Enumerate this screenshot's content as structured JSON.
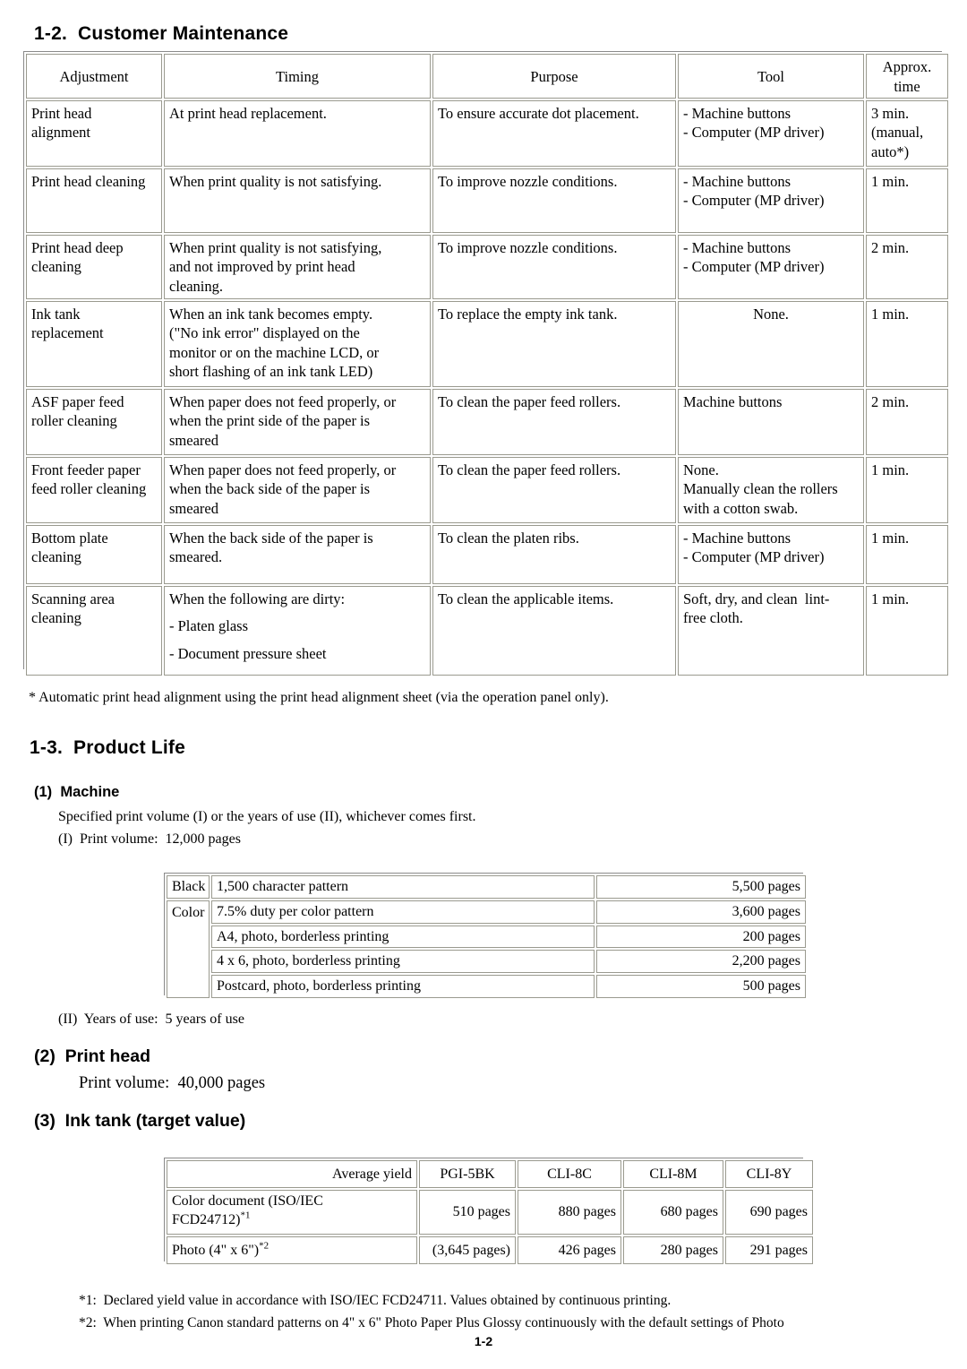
{
  "document": {
    "page_number": "1-2"
  },
  "section_maintenance": {
    "heading": "1-2.  Customer Maintenance",
    "table": {
      "headers": [
        "Adjustment",
        "Timing",
        "Purpose",
        "Tool",
        "Approx.\ntime"
      ],
      "header_tool_time_line1": "Approx.",
      "header_tool_time_line2": "time",
      "rows": [
        {
          "adjustment": [
            "Print head",
            "alignment"
          ],
          "timing": [
            "At print head replacement."
          ],
          "purpose": [
            "To ensure accurate dot placement."
          ],
          "tool": [
            "- Machine buttons",
            "- Computer (MP driver)"
          ],
          "time": [
            "3 min.",
            "(manual,",
            "auto*)"
          ]
        },
        {
          "adjustment": [
            "Print head cleaning"
          ],
          "timing": [
            "When print quality is not satisfying."
          ],
          "purpose": [
            "To improve nozzle conditions."
          ],
          "tool": [
            "- Machine buttons",
            "- Computer (MP driver)"
          ],
          "time": [
            "1 min."
          ]
        },
        {
          "adjustment": [
            "Print head deep",
            "cleaning"
          ],
          "timing": [
            "When print quality is not satisfying,",
            "and not improved by print head",
            "cleaning."
          ],
          "purpose": [
            "To improve nozzle conditions."
          ],
          "tool": [
            "- Machine buttons",
            "- Computer (MP driver)"
          ],
          "time": [
            "2 min."
          ]
        },
        {
          "adjustment": [
            "Ink tank",
            "replacement"
          ],
          "timing": [
            "When an ink tank becomes empty.",
            "(\"No ink error\" displayed on the",
            "monitor or on the machine LCD, or",
            "short flashing of an ink tank LED)"
          ],
          "purpose": [
            "To replace the empty ink tank."
          ],
          "tool": [
            "None."
          ],
          "time": [
            "1 min."
          ]
        },
        {
          "adjustment": [
            "ASF paper feed",
            "roller cleaning"
          ],
          "timing": [
            "When paper does not feed properly, or",
            "when the print side of the paper is",
            "smeared"
          ],
          "purpose": [
            "To clean the paper feed rollers."
          ],
          "tool": [
            "Machine buttons"
          ],
          "time": [
            "2 min."
          ]
        },
        {
          "adjustment": [
            "Front feeder paper",
            "feed roller cleaning"
          ],
          "timing": [
            "When paper does not feed properly, or",
            "when the back side of the paper is",
            "smeared"
          ],
          "purpose": [
            "To clean the paper feed rollers."
          ],
          "tool": [
            "None.",
            "Manually clean the rollers",
            "with a cotton swab."
          ],
          "time": [
            "1 min."
          ]
        },
        {
          "adjustment": [
            "Bottom plate",
            "cleaning"
          ],
          "timing": [
            "When the back side of the paper is",
            "smeared."
          ],
          "purpose": [
            "To clean the platen ribs."
          ],
          "tool": [
            "- Machine buttons",
            "- Computer (MP driver)"
          ],
          "time": [
            "1 min."
          ]
        },
        {
          "adjustment": [
            "Scanning area",
            "cleaning"
          ],
          "timing": [
            "When the following are dirty:",
            "- Platen glass",
            "- Document pressure sheet"
          ],
          "purpose": [
            "To clean the applicable items."
          ],
          "tool": [
            "Soft, dry, and clean  lint-",
            "free cloth."
          ],
          "time": [
            "1 min."
          ]
        }
      ]
    },
    "footnote": "* Automatic print head alignment using the print head alignment sheet (via the operation panel only)."
  },
  "section_product_life": {
    "heading": "1-3.  Product Life",
    "machine": {
      "heading": "(1)  Machine",
      "line1": "Specified print volume (I) or the years of use (II), whichever comes first.",
      "line2": "(I)  Print volume:  12,000 pages",
      "line3": "(II)  Years of use:  5 years of use",
      "yield_table": {
        "rows": [
          {
            "group": "Black",
            "pattern": "1,500 character pattern",
            "yield": "5,500 pages"
          },
          {
            "group": "Color",
            "pattern": "7.5% duty per color pattern",
            "yield": "3,600 pages"
          },
          {
            "group": "",
            "pattern": "A4, photo, borderless printing",
            "yield": "200 pages"
          },
          {
            "group": "",
            "pattern": "4 x 6, photo, borderless printing",
            "yield": "2,200 pages"
          },
          {
            "group": "",
            "pattern": "Postcard, photo, borderless printing",
            "yield": "500 pages"
          }
        ]
      }
    },
    "print_head": {
      "heading": "(2)  Print head",
      "line1": "Print volume:  40,000 pages"
    },
    "ink_tank": {
      "heading": "(3)  Ink tank (target value)",
      "table": {
        "headers": [
          "Average yield",
          "PGI-5BK",
          "CLI-8C",
          "CLI-8M",
          "CLI-8Y"
        ],
        "rows": [
          {
            "label_line1": "Color document (ISO/IEC",
            "label_line2": "FCD24712)",
            "label_footnote": "*1",
            "values": [
              "510 pages",
              "880 pages",
              "680 pages",
              "690 pages"
            ]
          },
          {
            "label_line1": "Photo (4\" x 6\")",
            "label_line2": "",
            "label_footnote": "*2",
            "values": [
              "(3,645 pages)",
              "426 pages",
              "280 pages",
              "291 pages"
            ]
          }
        ]
      }
    },
    "footnotes": [
      "*1:  Declared yield value in accordance with ISO/IEC FCD24711. Values obtained by continuous printing.",
      "*2:  When printing Canon standard patterns on 4\" x 6\" Photo Paper Plus Glossy continuously with the default settings of Photo"
    ]
  }
}
